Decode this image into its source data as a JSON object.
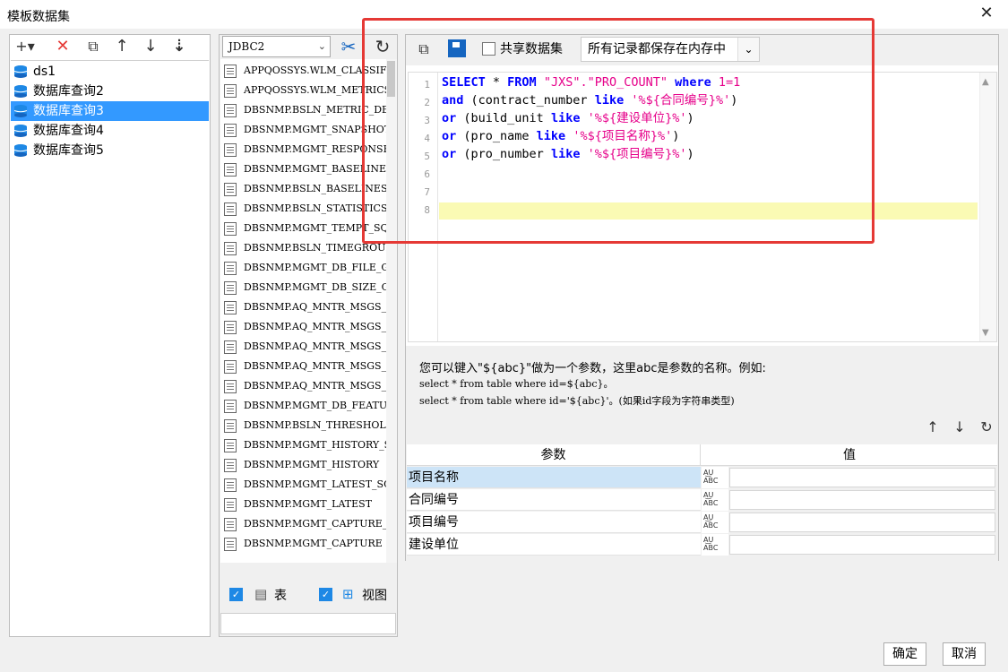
{
  "window": {
    "title": "模板数据集",
    "close_glyph": "✕"
  },
  "left_toolbar": {
    "add_glyph": "+▾",
    "delete_glyph": "✕",
    "copy_glyph": "⧉",
    "up_glyph": "↑",
    "down_glyph": "↓",
    "sort_glyph": "⇣"
  },
  "datasets": [
    {
      "label": "ds1",
      "selected": false
    },
    {
      "label": "数据库查询2",
      "selected": false
    },
    {
      "label": "数据库查询3",
      "selected": true
    },
    {
      "label": "数据库查询4",
      "selected": false
    },
    {
      "label": "数据库查询5",
      "selected": false
    }
  ],
  "connection": {
    "value": "JDBC2",
    "arrow": "⌄",
    "tools_glyph": "✂",
    "refresh_glyph": "↻"
  },
  "tables": [
    "APPQOSSYS.WLM_CLASSIFI",
    "APPQOSSYS.WLM_METRICS_",
    "DBSNMP.BSLN_METRIC_DEF",
    "DBSNMP.MGMT_SNAPSHOT",
    "DBSNMP.MGMT_RESPONSE_C",
    "DBSNMP.MGMT_BASELINE",
    "DBSNMP.BSLN_BASELINES",
    "DBSNMP.BSLN_STATISTICS",
    "DBSNMP.MGMT_TEMPT_SQL",
    "DBSNMP.BSLN_TIMEGROUPS",
    "DBSNMP.MGMT_DB_FILE_GT",
    "DBSNMP.MGMT_DB_SIZE_GT",
    "DBSNMP.AQ_MNTR_MSGS_BT",
    "DBSNMP.AQ_MNTR_MSGS_PE",
    "DBSNMP.AQ_MNTR_MSGS_PS",
    "DBSNMP.AQ_MNTR_MSGS_ST",
    "DBSNMP.AQ_MNTR_MSGS_QU",
    "DBSNMP.MGMT_DB_FEATURE",
    "DBSNMP.BSLN_THRESHOLD_",
    "DBSNMP.MGMT_HISTORY_SQ",
    "DBSNMP.MGMT_HISTORY",
    "DBSNMP.MGMT_LATEST_SQL",
    "DBSNMP.MGMT_LATEST",
    "DBSNMP.MGMT_CAPTURE_SQ",
    "DBSNMP.MGMT_CAPTURE"
  ],
  "filters": {
    "table_label": "表",
    "view_label": "视图",
    "check_glyph": "✓",
    "table_icon": "▤",
    "view_icon": "⊞"
  },
  "right_toolbar": {
    "preview_glyph": "⧉",
    "share_label": "共享数据集",
    "memory_option": "所有记录都保存在内存中",
    "arrow": "⌄"
  },
  "editor": {
    "line_numbers": [
      "1",
      "2",
      "3",
      "4",
      "5",
      "6",
      "7",
      "8"
    ],
    "lines": [
      [
        {
          "t": "SELECT",
          "c": "kw"
        },
        {
          "t": " * ",
          "c": "plain"
        },
        {
          "t": "FROM",
          "c": "kw"
        },
        {
          "t": " ",
          "c": "plain"
        },
        {
          "t": "\"JXS\".\"PRO_COUNT\"",
          "c": "str"
        },
        {
          "t": " ",
          "c": "plain"
        },
        {
          "t": "where",
          "c": "kw"
        },
        {
          "t": " 1=1",
          "c": "str"
        }
      ],
      [
        {
          "t": "and",
          "c": "kw"
        },
        {
          "t": " (contract_number ",
          "c": "plain"
        },
        {
          "t": "like",
          "c": "kw"
        },
        {
          "t": " ",
          "c": "plain"
        },
        {
          "t": "'%${合同编号}%'",
          "c": "str"
        },
        {
          "t": ")",
          "c": "plain"
        }
      ],
      [
        {
          "t": "or",
          "c": "kw"
        },
        {
          "t": " (build_unit ",
          "c": "plain"
        },
        {
          "t": "like",
          "c": "kw"
        },
        {
          "t": " ",
          "c": "plain"
        },
        {
          "t": "'%${建设单位}%'",
          "c": "str"
        },
        {
          "t": ")",
          "c": "plain"
        }
      ],
      [
        {
          "t": "or",
          "c": "kw"
        },
        {
          "t": " (pro_name ",
          "c": "plain"
        },
        {
          "t": "like",
          "c": "kw"
        },
        {
          "t": " ",
          "c": "plain"
        },
        {
          "t": "'%${项目名称}%'",
          "c": "str"
        },
        {
          "t": ")",
          "c": "plain"
        }
      ],
      [
        {
          "t": "or",
          "c": "kw"
        },
        {
          "t": " (pro_number ",
          "c": "plain"
        },
        {
          "t": "like",
          "c": "kw"
        },
        {
          "t": " ",
          "c": "plain"
        },
        {
          "t": "'%${项目编号}%'",
          "c": "str"
        },
        {
          "t": ")",
          "c": "plain"
        }
      ]
    ],
    "scroll_up": "▲",
    "scroll_down": "▼"
  },
  "help": {
    "line1": "您可以键入\"${abc}\"做为一个参数，这里abc是参数的名称。例如:",
    "line2": "select * from table where id=${abc}。",
    "line3": "select * from table where id='${abc}'。(如果id字段为字符串类型)"
  },
  "param_buttons": {
    "up": "↑",
    "down": "↓",
    "refresh": "↻"
  },
  "params": {
    "header_name": "参数",
    "header_value": "值",
    "type_icon": "A͜U ABC",
    "rows": [
      {
        "name": "项目名称",
        "value": "",
        "selected": true
      },
      {
        "name": "合同编号",
        "value": "",
        "selected": false
      },
      {
        "name": "项目编号",
        "value": "",
        "selected": false
      },
      {
        "name": "建设单位",
        "value": "",
        "selected": false
      }
    ]
  },
  "footer": {
    "ok_label": "确定",
    "cancel_label": "取消"
  },
  "colors": {
    "accent": "#3399ff",
    "keyword": "#0000ff",
    "string": "#e6008a",
    "highlight_line": "#fafab4",
    "annotation_box": "#e53935"
  }
}
